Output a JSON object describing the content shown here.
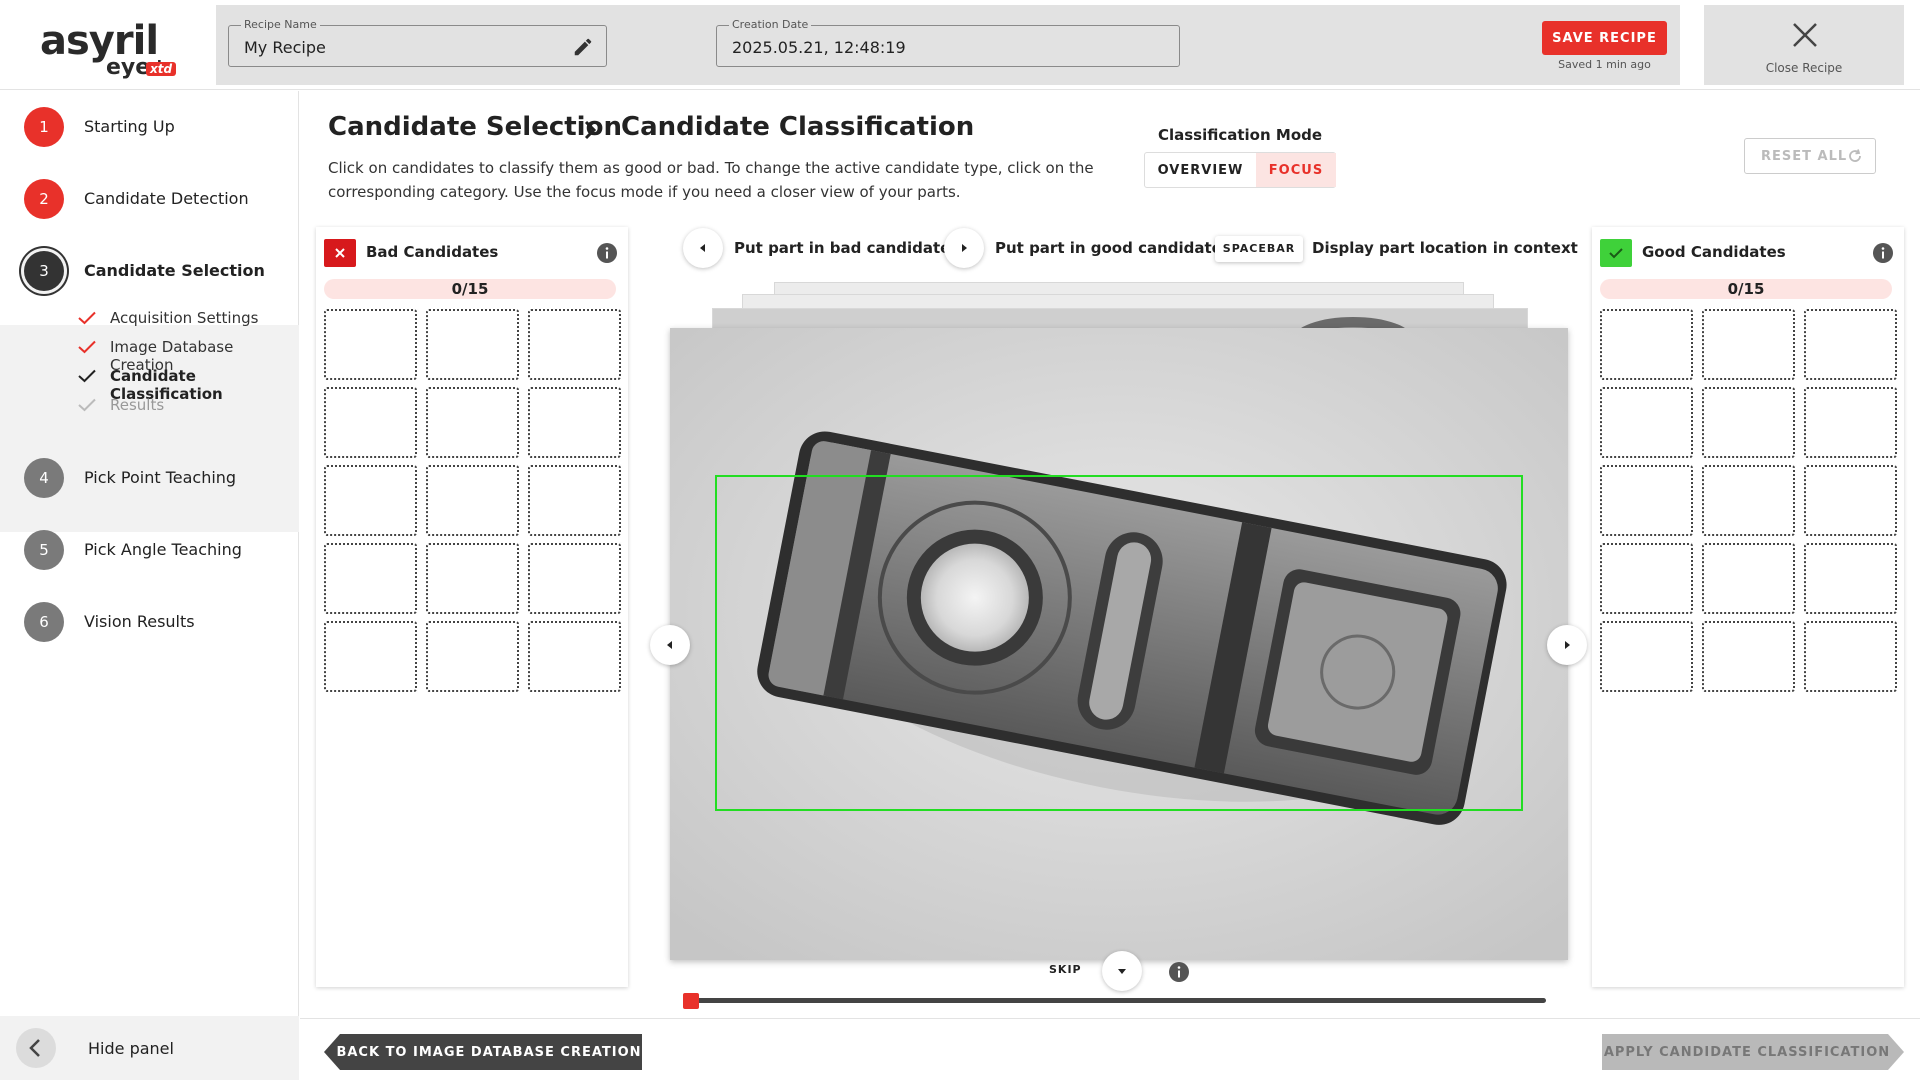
{
  "app": {
    "logo_main": "asyril",
    "logo_sub": "eye+",
    "logo_badge": "xtd"
  },
  "header": {
    "recipe_name_legend": "Recipe Name",
    "recipe_name_value": "My Recipe",
    "creation_date_legend": "Creation Date",
    "creation_date_value": "2025.05.21, 12:48:19",
    "save_label": "SAVE RECIPE",
    "saved_status": "Saved 1 min ago",
    "close_label": "Close Recipe",
    "accent_color": "#e8312a"
  },
  "sidebar": {
    "steps": [
      {
        "num": "1",
        "label": "Starting Up"
      },
      {
        "num": "2",
        "label": "Candidate Detection"
      },
      {
        "num": "3",
        "label": "Candidate Selection"
      },
      {
        "num": "4",
        "label": "Pick Point Teaching"
      },
      {
        "num": "5",
        "label": "Pick Angle Teaching"
      },
      {
        "num": "6",
        "label": "Vision Results"
      }
    ],
    "substeps": [
      {
        "label": "Acquisition Settings",
        "state": "done"
      },
      {
        "label": "Image Database Creation",
        "state": "done"
      },
      {
        "label": "Candidate Classification",
        "state": "current"
      },
      {
        "label": "Results",
        "state": "pending"
      }
    ],
    "hide_panel_label": "Hide panel"
  },
  "main": {
    "breadcrumb_parent": "Candidate Selection",
    "breadcrumb_current": "Candidate Classification",
    "description": "Click on candidates to classify them as good or bad. To change the active candidate type, click on the corresponding category. Use the focus mode if you need a closer view of your parts.",
    "mode_title": "Classification Mode",
    "mode_overview": "OVERVIEW",
    "mode_focus": "FOCUS",
    "mode_selected": "FOCUS",
    "reset_label": "RESET ALL"
  },
  "bad_panel": {
    "title": "Bad Candidates",
    "count": "0/15",
    "color": "#d7191c"
  },
  "good_panel": {
    "title": "Good Candidates",
    "count": "0/15",
    "color": "#3fd13a"
  },
  "controls": {
    "bad_hint": "Put part in bad candidates",
    "good_hint": "Put part in good candidates",
    "key_label": "SPACEBAR",
    "key_hint": "Display part location in context",
    "skip_label": "SKIP",
    "slider_position": 0
  },
  "footer": {
    "back_label": "BACK TO IMAGE DATABASE CREATION",
    "apply_label": "APPLY CANDIDATE CLASSIFICATION"
  }
}
